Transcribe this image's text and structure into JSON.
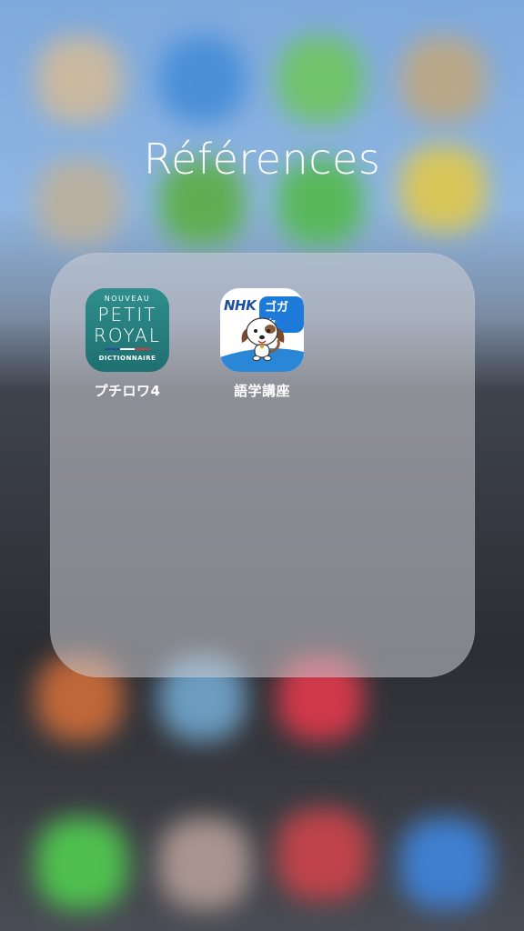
{
  "folder": {
    "title": "Références"
  },
  "apps": [
    {
      "label": "プチロワ4",
      "icon": {
        "name": "petit-royal-dictionary-icon",
        "line1": "NOUVEAU",
        "line2": "PETIT",
        "line3": "ROYAL",
        "line4": "DICTIONNAIRE"
      }
    },
    {
      "label": "語学講座",
      "icon": {
        "name": "nhk-gogaku-icon",
        "logo": "NHK",
        "badge": "ゴガク"
      }
    }
  ],
  "colors": {
    "petit_royal_bg": "#2a8585",
    "nhk_blue": "#1e4fa0",
    "gogaku_blue": "#1e7ad8",
    "folder_panel": "rgba(205,205,212,0.55)"
  }
}
